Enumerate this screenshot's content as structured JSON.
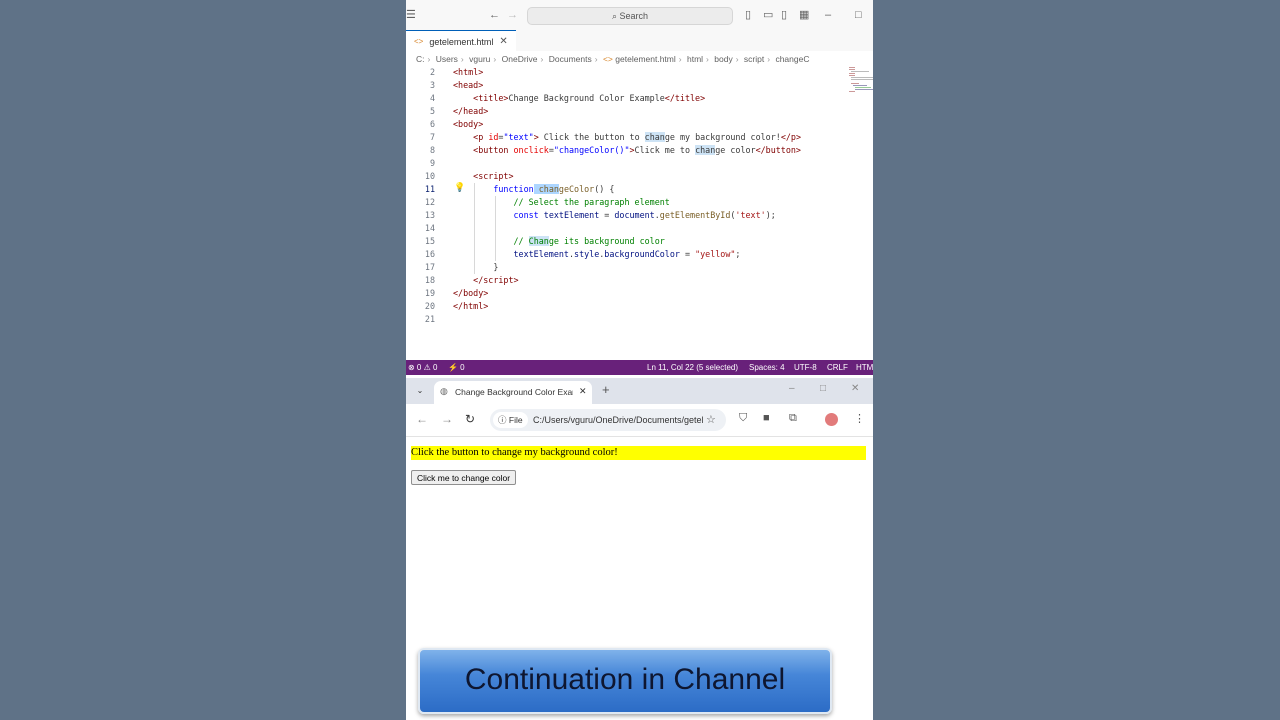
{
  "vscode": {
    "search_placeholder": "Search",
    "tab_label": "getelement.html",
    "breadcrumb": [
      "C:",
      "Users",
      "vguru",
      "OneDrive",
      "Documents",
      "getelement.html",
      "html",
      "body",
      "script",
      "changeC"
    ],
    "line_numbers": [
      "2",
      "3",
      "4",
      "5",
      "6",
      "7",
      "8",
      "9",
      "10",
      "11",
      "12",
      "13",
      "14",
      "15",
      "16",
      "17",
      "18",
      "19",
      "20",
      "21"
    ],
    "active_line": "11",
    "status": {
      "problems": "⊗ 0 ⚠ 0",
      "ports": "⚡ 0",
      "position": "Ln 11, Col 22 (5 selected)",
      "spaces": "Spaces: 4",
      "encoding": "UTF-8",
      "eol": "CRLF",
      "language": "HTML"
    }
  },
  "browser": {
    "tab_title": "Change Background Color Example",
    "file_chip": "File",
    "url": "C:/Users/vguru/OneDrive/Documents/getelement.html",
    "page": {
      "paragraph": "Click the button to change my background color!",
      "button": "Click me to change color",
      "paragraph_bg": "#ffff00"
    }
  },
  "banner": {
    "text": "Continuation in Channel"
  },
  "colors": {
    "statusbar": "#68217a",
    "desktop": "#5f7287"
  }
}
